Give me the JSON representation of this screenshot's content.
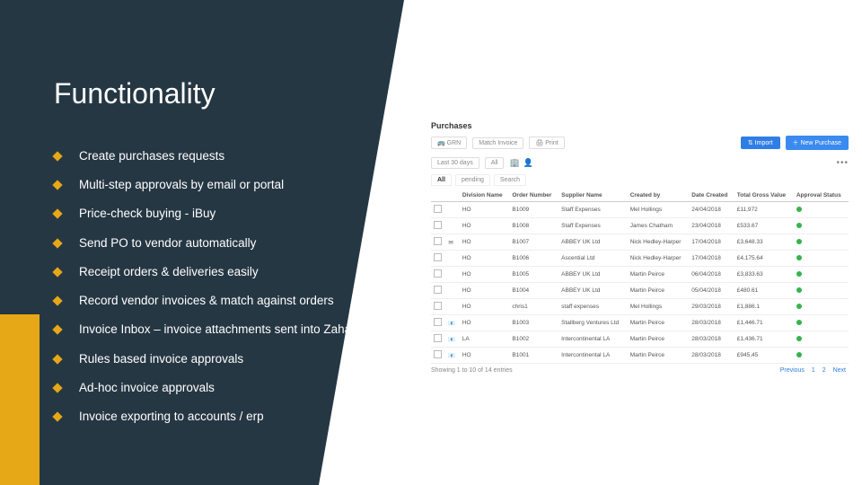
{
  "title": "Functionality",
  "bullets": [
    "Create purchases requests",
    "Multi-step approvals by email or portal",
    "Price-check buying - iBuy",
    "Send PO to vendor automatically",
    "Receipt orders & deliveries easily",
    "Record vendor invoices & match against orders",
    "Invoice Inbox – invoice attachments sent into Zahara",
    "Rules based invoice approvals",
    "Ad-hoc invoice approvals",
    "Invoice exporting to accounts / erp"
  ],
  "screenshot": {
    "heading": "Purchases",
    "toolbar": {
      "grn": "GRN",
      "match": "Match Invoice",
      "print": "Print",
      "import": "Import",
      "new": "New Purchase"
    },
    "filter_label": "Last 30 days",
    "tabs": {
      "all": "All",
      "pending": "pending",
      "search": "Search"
    },
    "columns": [
      "",
      "",
      "Division Name",
      "Order Number",
      "Supplier Name",
      "Created by",
      "Date Created",
      "Total Gross Value",
      "Approval Status"
    ],
    "rows": [
      {
        "flag": "",
        "div": "HO",
        "num": "B1009",
        "sup": "Staff Expenses",
        "by": "Mel Hollings",
        "date": "24/04/2018",
        "val": "£11,972"
      },
      {
        "flag": "",
        "div": "HO",
        "num": "B1008",
        "sup": "Staff Expenses",
        "by": "James Chatham",
        "date": "23/04/2018",
        "val": "£533.67"
      },
      {
        "flag": "✉",
        "div": "HO",
        "num": "B1007",
        "sup": "ABBEY UK Ltd",
        "by": "Nick Hedley-Harper",
        "date": "17/04/2018",
        "val": "£3,648.33"
      },
      {
        "flag": "",
        "div": "HO",
        "num": "B1006",
        "sup": "Ascential Ltd",
        "by": "Nick Hedley-Harper",
        "date": "17/04/2018",
        "val": "£4,175.64"
      },
      {
        "flag": "",
        "div": "HO",
        "num": "B1005",
        "sup": "ABBEY UK Ltd",
        "by": "Martin Peirce",
        "date": "06/04/2018",
        "val": "£3,833.63"
      },
      {
        "flag": "",
        "div": "HO",
        "num": "B1004",
        "sup": "ABBEY UK Ltd",
        "by": "Martin Peirce",
        "date": "05/04/2018",
        "val": "£480.61"
      },
      {
        "flag": "",
        "div": "HO",
        "num": "chris1",
        "sup": "staff expenses",
        "by": "Mel Hollings",
        "date": "29/03/2018",
        "val": "£1,886.1"
      },
      {
        "flag": "📧",
        "div": "HO",
        "num": "B1003",
        "sup": "Stallberg Ventures Ltd",
        "by": "Martin Peirce",
        "date": "28/03/2018",
        "val": "£1,446.71"
      },
      {
        "flag": "📧",
        "div": "LA",
        "num": "B1002",
        "sup": "Intercontinental LA",
        "by": "Martin Peirce",
        "date": "28/03/2018",
        "val": "£1,436.71"
      },
      {
        "flag": "📧",
        "div": "HO",
        "num": "B1001",
        "sup": "Intercontinental LA",
        "by": "Martin Peirce",
        "date": "28/03/2018",
        "val": "£945.45"
      }
    ],
    "pager": {
      "showing": "Showing 1 to 10 of 14 entries",
      "prev": "Previous",
      "next": "Next"
    }
  }
}
